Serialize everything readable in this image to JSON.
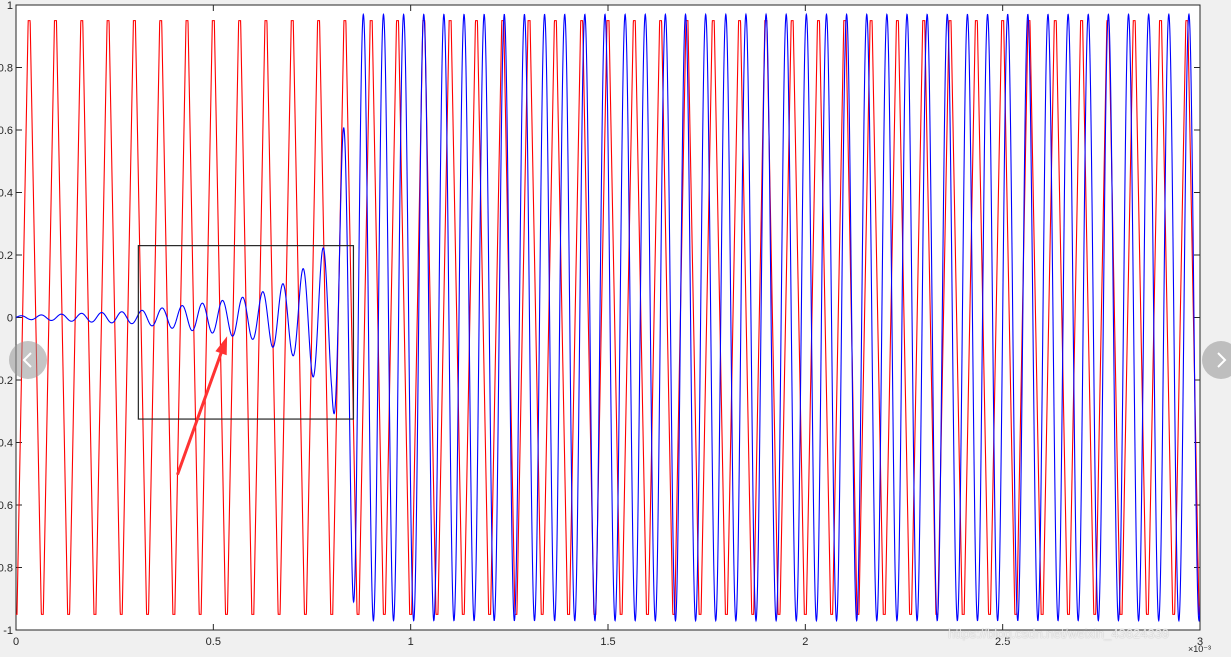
{
  "title": "",
  "nav": {
    "prev_icon": "chevron-left-icon",
    "next_icon": "chevron-right-icon"
  },
  "watermark": "https://blog.csdn.net/weixin_43624339",
  "x_exponent_label": "×10⁻³",
  "chart_data": {
    "type": "line",
    "xlim": [
      0,
      3.0
    ],
    "ylim": [
      -1,
      1
    ],
    "x_ticks": [
      0,
      0.5,
      1,
      1.5,
      2,
      2.5,
      3
    ],
    "x_tick_labels": [
      "0",
      "0.5",
      "1",
      "1.5",
      "2",
      "2.5",
      "3"
    ],
    "y_ticks": [
      -1,
      -0.8,
      -0.6,
      -0.4,
      -0.2,
      0,
      0.2,
      0.4,
      0.6,
      0.8,
      1
    ],
    "y_tick_labels": [
      "-1",
      "-0.8",
      "-0.6",
      "-0.4",
      "-0.2",
      "0",
      "0.2",
      "0.4",
      "0.6",
      "0.8",
      "1"
    ],
    "grid": false,
    "colors": {
      "series1": "#ff0000",
      "series2": "#0000ff",
      "axes": "#262626",
      "annotation": "#ff3333",
      "box": "#262626"
    },
    "series": [
      {
        "color": "#ff0000",
        "description": "trapezoid carrier, amplitude 0.95, ~15 kHz",
        "amplitude": 0.95,
        "frequency_cycles_per_unit": 15.0,
        "phase_offset": 0.0
      },
      {
        "color": "#0000ff",
        "description": "oscillation growing from ~0 to ~1 by x≈0.86, then steady",
        "steady_amplitude": 0.97,
        "frequency_cycles_per_unit": 19.6,
        "growth_end_x": 0.86,
        "envelope_points": [
          [
            0,
            0.005
          ],
          [
            0.1,
            0.01
          ],
          [
            0.2,
            0.015
          ],
          [
            0.3,
            0.02
          ],
          [
            0.4,
            0.035
          ],
          [
            0.5,
            0.05
          ],
          [
            0.6,
            0.07
          ],
          [
            0.7,
            0.12
          ],
          [
            0.76,
            0.2
          ],
          [
            0.8,
            0.25
          ],
          [
            0.86,
            0.97
          ],
          [
            3.0,
            0.97
          ]
        ]
      }
    ],
    "annotations": [
      {
        "type": "rect",
        "x": [
          0.31,
          0.855
        ],
        "y": [
          -0.325,
          0.23
        ]
      },
      {
        "type": "arrow",
        "from": [
          0.41,
          -0.5
        ],
        "to": [
          0.535,
          -0.06
        ]
      }
    ]
  }
}
